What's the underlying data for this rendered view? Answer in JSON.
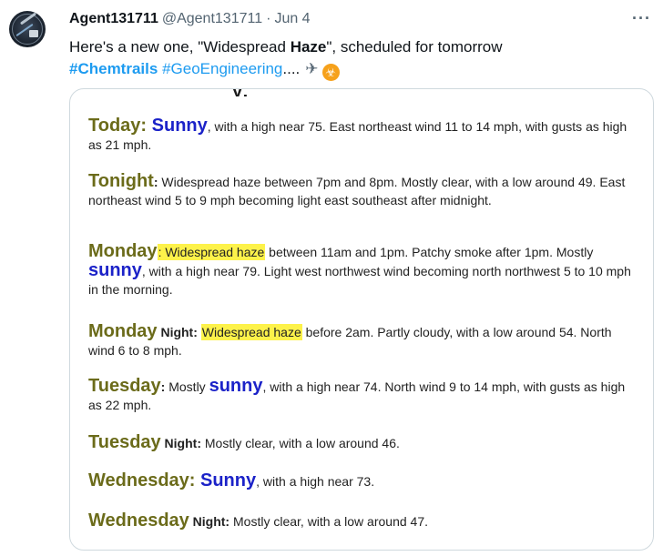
{
  "tweet": {
    "author_name": "Agent131711",
    "handle": "@Agent131711",
    "separator": "·",
    "date": "Jun 4",
    "more": "···",
    "text_before": "Here's a new one, \"Widespread ",
    "text_bold": "Haze",
    "text_after": "\", scheduled for tomorrow",
    "hashtag_1": "#Chemtrails",
    "hashtag_2": "#GeoEngineering",
    "ellipsis": "....",
    "emoji_1": "✈",
    "emoji_2": "☣"
  },
  "forecast": {
    "top_fragment": "y,",
    "today": {
      "label": "Today",
      "colon": ": ",
      "sunny": "Sunny",
      "text": ", with a high near 75. East northeast wind 11 to 14 mph, with gusts as high as 21 mph."
    },
    "tonight": {
      "label": "Tonight",
      "colon": ": ",
      "text": "Widespread haze between 7pm and 8pm. Mostly clear, with a low around 49. East northeast wind 5 to 9 mph becoming light east southeast after midnight."
    },
    "monday": {
      "label": "Monday",
      "highlight": ": Widespread haze",
      "text_1": " between 11am and 1pm. Patchy smoke after 1pm. Mostly ",
      "sunny": "sunny",
      "text_2": ", with a high near 79. Light west northwest wind becoming north northwest 5 to 10 mph in the morning."
    },
    "monday_night": {
      "label": "Monday",
      "night": " Night:",
      "highlight": "Widespread haze",
      "text": " before 2am. Partly cloudy, with a low around 54. North wind 6 to 8 mph."
    },
    "tuesday": {
      "label": "Tuesday",
      "colon": ": ",
      "mostly": "Mostly ",
      "sunny": "sunny",
      "text": ", with a high near 74. North wind 9 to 14 mph, with gusts as high as 22 mph."
    },
    "tuesday_night": {
      "label": "Tuesday",
      "night": " Night:",
      "text": " Mostly clear, with a low around 46."
    },
    "wednesday": {
      "label": "Wednesday",
      "colon": ": ",
      "sunny": "Sunny",
      "text": ", with a high near 73."
    },
    "wednesday_night": {
      "label": "Wednesday",
      "night": " Night:",
      "text": " Mostly clear, with a low around 47."
    }
  },
  "colors": {
    "day_label": "#6b6b1a",
    "sunny": "#1b22c8",
    "highlight": "#fdf24a",
    "hashtag": "#1d9bf0"
  },
  "icons": {
    "avatar": "avatar-image",
    "more": "more-options-icon"
  }
}
